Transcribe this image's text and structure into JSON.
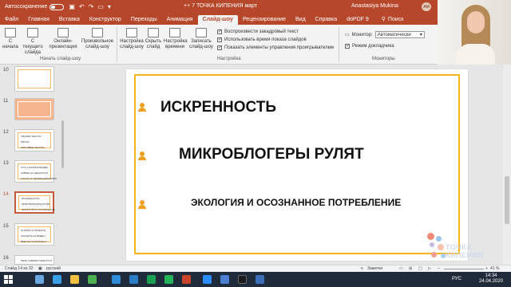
{
  "titlebar": {
    "autosave_label": "Автосохранение",
    "doc_title": "++ 7 ТОЧКА КИПЕНИЯ март",
    "user_name": "Anastasiya Mukina",
    "user_initials": "AM"
  },
  "tabs": [
    {
      "label": "Файл",
      "active": false
    },
    {
      "label": "Главная",
      "active": false
    },
    {
      "label": "Вставка",
      "active": false
    },
    {
      "label": "Конструктор",
      "active": false
    },
    {
      "label": "Переходы",
      "active": false
    },
    {
      "label": "Анимация",
      "active": false
    },
    {
      "label": "Слайд-шоу",
      "active": true
    },
    {
      "label": "Рецензирование",
      "active": false
    },
    {
      "label": "Вид",
      "active": false
    },
    {
      "label": "Справка",
      "active": false
    },
    {
      "label": "doPDF 9",
      "active": false
    }
  ],
  "search_label": "Поиск",
  "ribbon": {
    "btn_from_start": "С начала",
    "btn_from_current": "С текущего слайда",
    "btn_online": "Онлайн-презентация",
    "btn_custom": "Произвольное слайд-шоу",
    "group_start": "Начать слайд-шоу",
    "btn_setup": "Настройка слайд-шоу",
    "btn_hide": "Скрыть слайд",
    "btn_timing": "Настройка времени",
    "btn_record": "Записать слайд-шоу",
    "group_setup": "Настройка",
    "chk_narration": "Воспроизвести закадровый текст",
    "chk_timings": "Использовать время показа слайдов",
    "chk_controls": "Показать элементы управления проигрывателем",
    "monitor_label": "Монитор:",
    "monitor_value": "Автоматически",
    "chk_presenter": "Режим докладчика",
    "group_monitors": "Мониторы"
  },
  "thumbnails": [
    {
      "num": "10",
      "lines": [],
      "style": "plain"
    },
    {
      "num": "11",
      "lines": [],
      "style": "salmon"
    },
    {
      "num": "12",
      "lines": [
        "УМНИКИ ТЕКСТЫ",
        "МАСКИ",
        "КРАСИВЫЕ ТЕКСТЫ"
      ],
      "style": "plain"
    },
    {
      "num": "13",
      "lines": [
        "ЧТО-А КОТЫНИ ВИДЕО",
        "ЖИВНЕ НА ЦЕННОСТИ",
        "ОТКАЗ ОТ ПЕРФЕКЦИОНИЗМА"
      ],
      "style": "plain"
    },
    {
      "num": "14",
      "lines": [
        "ИСКРЕННОСТЬ",
        "МИКРОБЛОГЕРЫ РУЛЯТ",
        "ЭКОЛОГИЯ И ОСОЗНАННОЕ"
      ],
      "style": "sel"
    },
    {
      "num": "15",
      "lines": [
        "ОНЛАЙН И ПРОЕКТЫ",
        "СЮЖЕТЫ НА ВИДЕО",
        "ВМЕСТЕ ПО БИЗНЕСУ"
      ],
      "style": "plain"
    },
    {
      "num": "16",
      "lines": [
        "ПЕРЕ СОВМЕСТНЫЕ РОСТ"
      ],
      "style": "plain"
    }
  ],
  "slide": {
    "items": [
      "ИСКРЕННОСТЬ",
      "МИКРОБЛОГЕРЫ РУЛЯТ",
      "ЭКОЛОГИЯ И ОСОЗНАННОЕ ПОТРЕБЛЕНИЕ"
    ],
    "accent_color": "#f4b41a"
  },
  "watermark": "ТОЧКА КИПЕНИЯ",
  "status": {
    "slide_counter": "Слайд 14 из 32",
    "language": "русский",
    "notes": "Заметки",
    "zoom": "41 %"
  },
  "taskbar": {
    "lang": "РУС",
    "time": "14:34",
    "date": "24.04.2020"
  }
}
